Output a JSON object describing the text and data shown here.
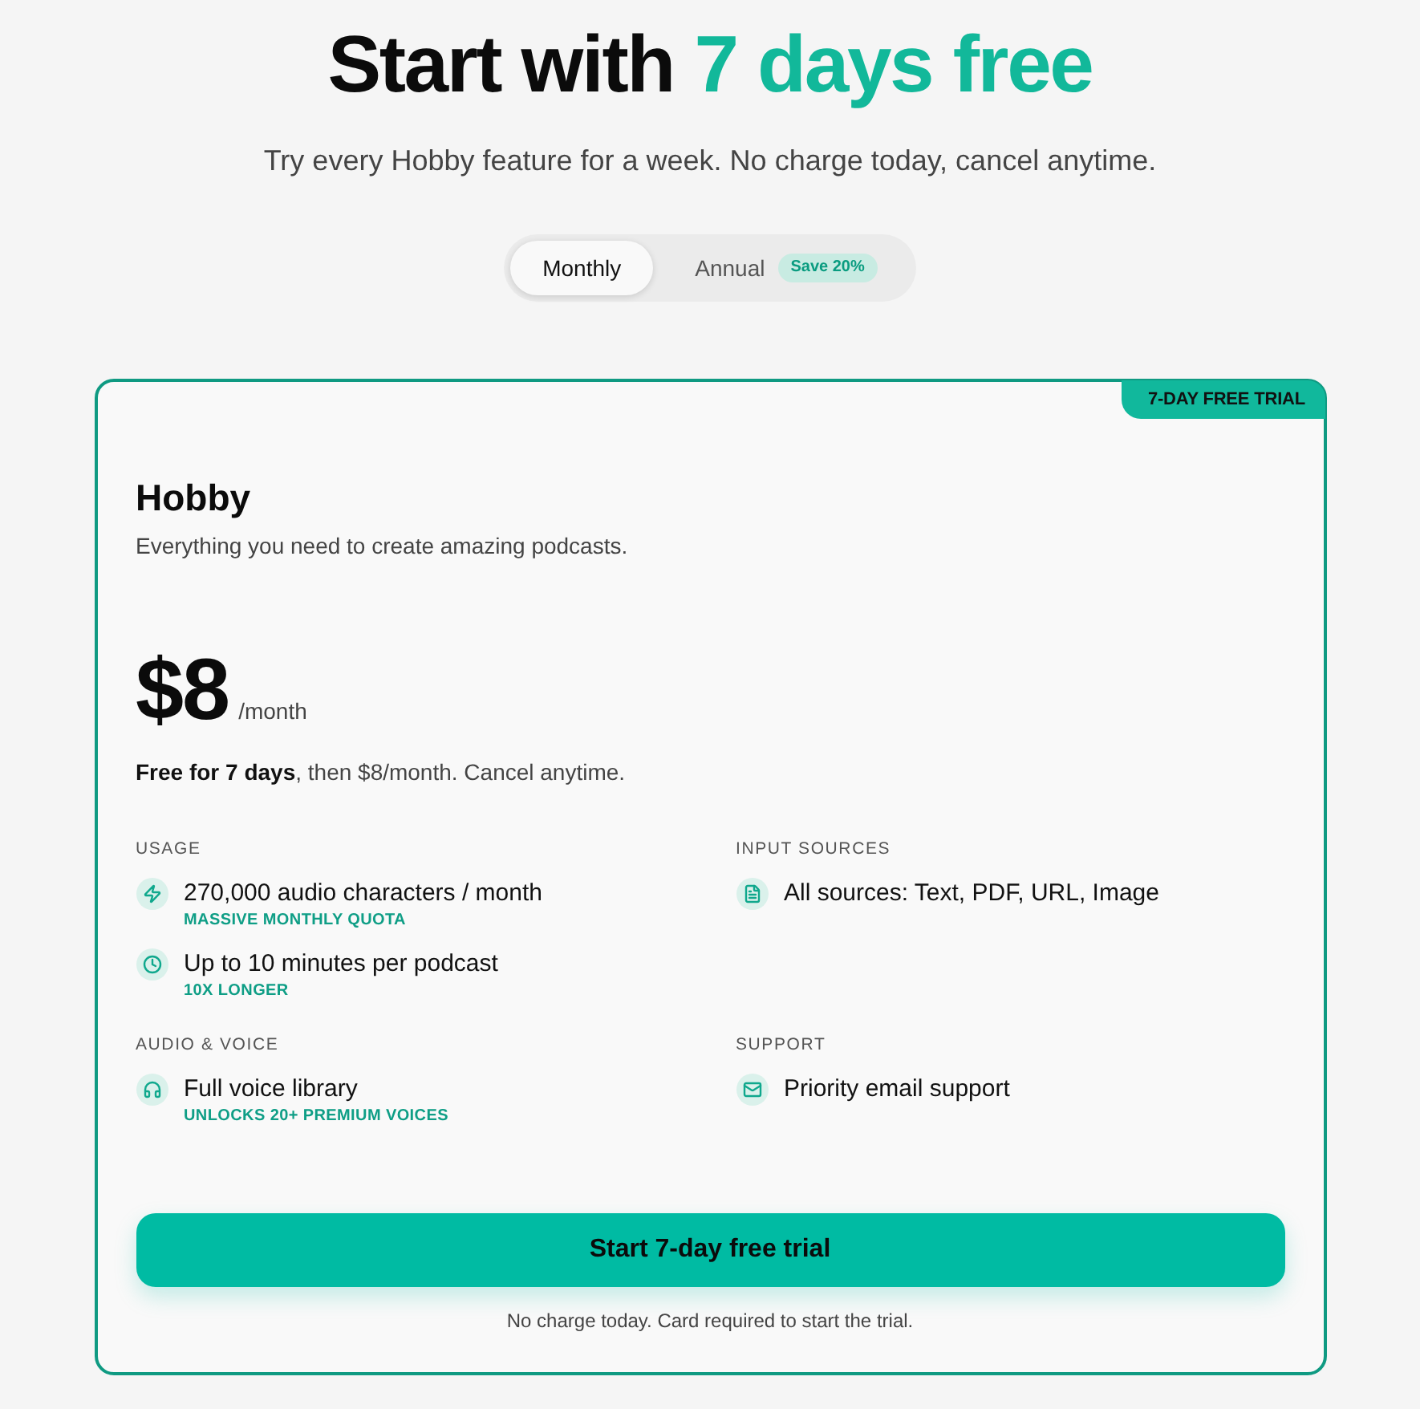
{
  "header": {
    "title_lead": "Start with",
    "title_highlight": "7 days free",
    "subtitle": "Try every Hobby feature for a week. No charge today, cancel anytime."
  },
  "billing_toggle": [
    {
      "label": "Monthly",
      "selected": true
    },
    {
      "label": "Annual",
      "selected": false,
      "badge": "Save 20%"
    }
  ],
  "plan": {
    "badge": "7-DAY FREE TRIAL",
    "name": "Hobby",
    "description": "Everything you need to create amazing podcasts.",
    "price": "$8",
    "period": "/month",
    "trial_note": "**Free for 7 days**, then $8/month. Cancel anytime.",
    "feature_groups": [
      {
        "heading": "USAGE",
        "items": [
          {
            "text": "270,000 audio characters / month",
            "note": "MASSIVE MONTHLY QUOTA"
          },
          {
            "text": "Up to 10 minutes per podcast",
            "note": "10X LONGER"
          }
        ]
      },
      {
        "heading": "INPUT SOURCES",
        "items": [
          {
            "text": "All sources: Text, PDF, URL, Image"
          }
        ]
      },
      {
        "heading": "AUDIO & VOICE",
        "items": [
          {
            "text": "Full voice library",
            "note": "UNLOCKS 20+ PREMIUM VOICES"
          }
        ]
      },
      {
        "heading": "SUPPORT",
        "items": [
          {
            "text": "Priority email support"
          }
        ]
      }
    ],
    "cta": "Start 7-day free trial",
    "footnote": "No charge today. Card required to start the trial."
  }
}
